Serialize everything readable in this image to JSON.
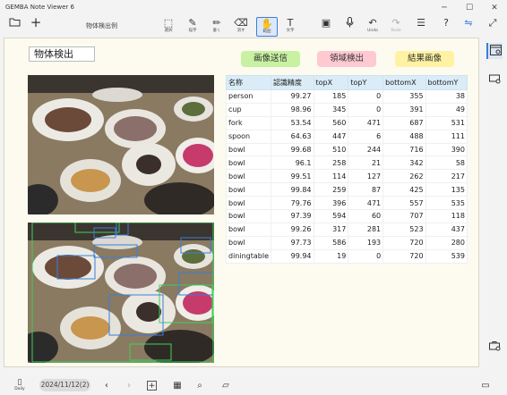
{
  "app": {
    "title": "GEMBA Note Viewer 6"
  },
  "window": {
    "minimize": "─",
    "maximize": "☐",
    "close": "✕"
  },
  "toolbar": {
    "doc_title": "物体検出例",
    "buttons": [
      {
        "name": "select",
        "icon": "⬚",
        "label": "選択"
      },
      {
        "name": "marker",
        "icon": "✎",
        "label": "描字"
      },
      {
        "name": "pen",
        "icon": "✏",
        "label": "書く"
      },
      {
        "name": "eraser",
        "icon": "⌫",
        "label": "消す"
      },
      {
        "name": "lasso",
        "icon": "✋",
        "label": "範囲"
      },
      {
        "name": "text",
        "icon": "T",
        "label": "文字"
      },
      {
        "name": "media",
        "icon": "▣",
        "label": ""
      },
      {
        "name": "mic",
        "icon": "🎙",
        "label": ""
      },
      {
        "name": "undo",
        "icon": "↶",
        "label": "Undo"
      },
      {
        "name": "redo",
        "icon": "↷",
        "label": "Redo"
      },
      {
        "name": "menu",
        "icon": "☰",
        "label": ""
      },
      {
        "name": "help",
        "icon": "?",
        "label": ""
      },
      {
        "name": "panel",
        "icon": "▤",
        "label": ""
      },
      {
        "name": "settings",
        "icon": "⇋",
        "label": ""
      },
      {
        "name": "expand",
        "icon": "⤢",
        "label": ""
      }
    ]
  },
  "page": {
    "heading": "物体検出",
    "actions": {
      "send": "画像送信",
      "detect": "領域検出",
      "result": "結果画像"
    }
  },
  "results": {
    "headers": [
      "名称",
      "認識精度",
      "topX",
      "topY",
      "bottomX",
      "bottomY"
    ],
    "rows": [
      [
        "person",
        "99.27",
        "185",
        "0",
        "355",
        "38"
      ],
      [
        "cup",
        "98.96",
        "345",
        "0",
        "391",
        "49"
      ],
      [
        "fork",
        "53.54",
        "560",
        "471",
        "687",
        "531"
      ],
      [
        "spoon",
        "64.63",
        "447",
        "6",
        "488",
        "111"
      ],
      [
        "bowl",
        "99.68",
        "510",
        "244",
        "716",
        "390"
      ],
      [
        "bowl",
        "96.1",
        "258",
        "21",
        "342",
        "58"
      ],
      [
        "bowl",
        "99.51",
        "114",
        "127",
        "262",
        "217"
      ],
      [
        "bowl",
        "99.84",
        "259",
        "87",
        "425",
        "135"
      ],
      [
        "bowl",
        "79.76",
        "396",
        "471",
        "557",
        "535"
      ],
      [
        "bowl",
        "97.39",
        "594",
        "60",
        "707",
        "118"
      ],
      [
        "bowl",
        "99.26",
        "317",
        "281",
        "523",
        "437"
      ],
      [
        "bowl",
        "97.73",
        "586",
        "193",
        "720",
        "280"
      ],
      [
        "diningtable",
        "99.94",
        "19",
        "0",
        "720",
        "539"
      ]
    ]
  },
  "footer": {
    "daily_label": "Daily",
    "date": "2024/11/12(2)",
    "prev": "‹",
    "next": "›",
    "add": "+",
    "calendar": "▦",
    "search": "⌕",
    "eraser": "▱",
    "monitor": "▭"
  }
}
